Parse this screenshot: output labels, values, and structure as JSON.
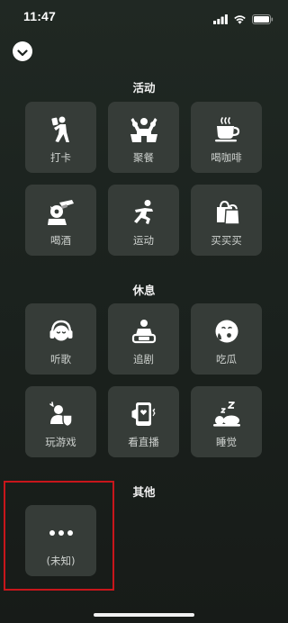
{
  "status_bar": {
    "time": "11:47"
  },
  "sections": [
    {
      "title": "活动",
      "items": [
        {
          "label": "打卡",
          "icon": "checkin-icon"
        },
        {
          "label": "聚餐",
          "icon": "dining-icon"
        },
        {
          "label": "喝咖啡",
          "icon": "coffee-icon"
        },
        {
          "label": "喝酒",
          "icon": "drink-icon"
        },
        {
          "label": "运动",
          "icon": "exercise-icon"
        },
        {
          "label": "买买买",
          "icon": "shopping-icon"
        }
      ]
    },
    {
      "title": "休息",
      "items": [
        {
          "label": "听歌",
          "icon": "headphones-icon"
        },
        {
          "label": "追剧",
          "icon": "tv-icon"
        },
        {
          "label": "吃瓜",
          "icon": "gossip-face-icon"
        },
        {
          "label": "玩游戏",
          "icon": "gaming-icon"
        },
        {
          "label": "看直播",
          "icon": "livestream-icon"
        },
        {
          "label": "睡觉",
          "icon": "sleep-icon"
        }
      ]
    },
    {
      "title": "其他",
      "items": [
        {
          "label": "(未知)",
          "icon": "more-dots-icon"
        }
      ]
    }
  ],
  "colors": {
    "tile_bg": "#363c38",
    "highlight": "#c8161b"
  }
}
